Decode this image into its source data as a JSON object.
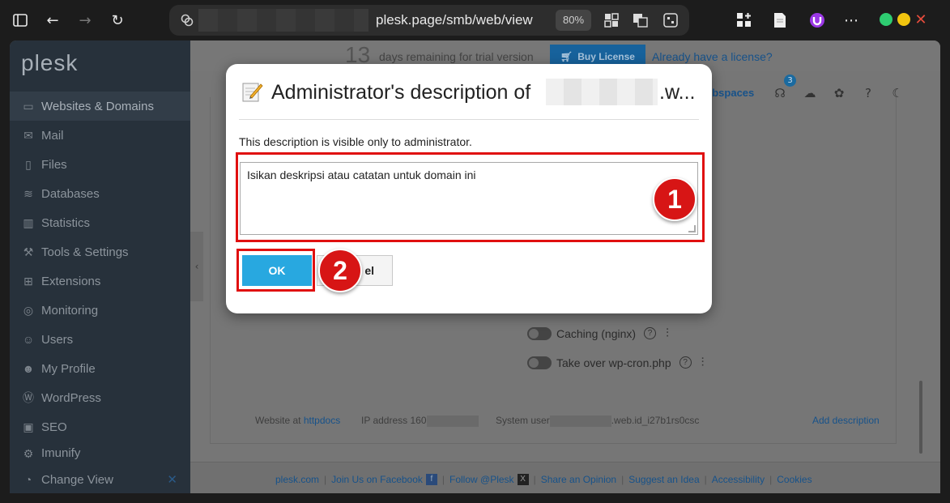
{
  "browser": {
    "url": "plesk.page/smb/web/view",
    "zoom": "80%",
    "colors": {
      "close": "#e74c3c",
      "minimize": "#f1c40f",
      "maximize": "#2ecc71"
    }
  },
  "sidebar": {
    "logo": "plesk",
    "items": [
      {
        "label": "Websites & Domains",
        "icon": "monitor-icon"
      },
      {
        "label": "Mail",
        "icon": "mail-icon"
      },
      {
        "label": "Files",
        "icon": "file-icon"
      },
      {
        "label": "Databases",
        "icon": "database-icon"
      },
      {
        "label": "Statistics",
        "icon": "statistics-icon"
      },
      {
        "label": "Tools & Settings",
        "icon": "tools-icon"
      },
      {
        "label": "Extensions",
        "icon": "extensions-icon"
      },
      {
        "label": "Monitoring",
        "icon": "monitoring-icon"
      },
      {
        "label": "Users",
        "icon": "users-icon"
      },
      {
        "label": "My Profile",
        "icon": "profile-icon"
      },
      {
        "label": "WordPress",
        "icon": "wordpress-icon"
      },
      {
        "label": "SEO",
        "icon": "seo-icon"
      },
      {
        "label": "Imunify",
        "icon": "imunify-icon"
      }
    ],
    "change_view": "Change View"
  },
  "trial": {
    "days": "13",
    "text": "days remaining for trial version",
    "buy_label": "Buy License",
    "license_link": "Already have a license?"
  },
  "topnav": {
    "webspaces": "ebspaces",
    "badge": "3"
  },
  "toggles": [
    {
      "label": "Caching (nginx)"
    },
    {
      "label": "Take over wp-cron.php"
    }
  ],
  "info": {
    "website_at": "Website at",
    "httpdocs": "httpdocs",
    "ip_label": "IP address",
    "ip_value": "160",
    "system_user": "System user",
    "system_user_suffix": ".web.id_i27b1rs0csc",
    "add_description": "Add description"
  },
  "footer": {
    "links": [
      "plesk.com",
      "Join Us on Facebook",
      "Follow @Plesk",
      "Share an Opinion",
      "Suggest an Idea",
      "Accessibility",
      "Cookies"
    ]
  },
  "dialog": {
    "title": "Administrator's description of",
    "title_suffix": ".w...",
    "hint": "This description is visible only to administrator.",
    "textarea_value": "Isikan deskripsi atau catatan untuk domain ini",
    "ok_label": "OK",
    "cancel_label": "el",
    "callouts": [
      "1",
      "2"
    ],
    "callout_color": "#e01010"
  }
}
